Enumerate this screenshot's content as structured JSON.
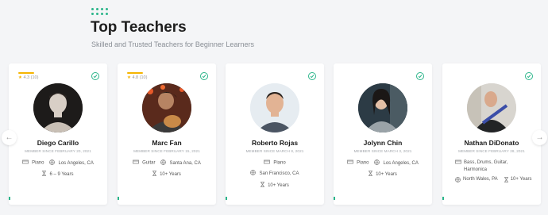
{
  "header": {
    "title": "Top Teachers",
    "subtitle": "Skilled and Trusted Teachers for Beginner Learners"
  },
  "accent_color": "#2bb58a",
  "star_color": "#f5b400",
  "teachers": [
    {
      "name": "Diego Carillo",
      "since": "MEMBER SINCE FEBRUARY 20, 2021",
      "rating": "4.3 (10)",
      "instrument": "Piano",
      "location": "Los Angeles, CA",
      "experience": "6 – 9 Years"
    },
    {
      "name": "Marc Fan",
      "since": "MEMBER SINCE FEBRUARY 15, 2021",
      "rating": "4.8 (10)",
      "instrument": "Guitar",
      "location": "Santa Ana, CA",
      "experience": "10+ Years"
    },
    {
      "name": "Roberto Rojas",
      "since": "MEMBER SINCE MARCH 8, 2021",
      "rating": "",
      "instrument": "Piano",
      "location": "San Francisco, CA",
      "experience": "10+ Years"
    },
    {
      "name": "Jolynn Chin",
      "since": "MEMBER SINCE MARCH 3, 2021",
      "rating": "",
      "instrument": "Piano",
      "location": "Los Angeles, CA",
      "experience": "10+ Years"
    },
    {
      "name": "Nathan DiDonato",
      "since": "MEMBER SINCE FEBRUARY 28, 2021",
      "rating": "",
      "instrument": "Bass, Drums, Guitar, Harmonica",
      "location": "North Wales, PA",
      "experience": "10+ Years"
    }
  ],
  "nav": {
    "prev": "←",
    "next": "→"
  }
}
